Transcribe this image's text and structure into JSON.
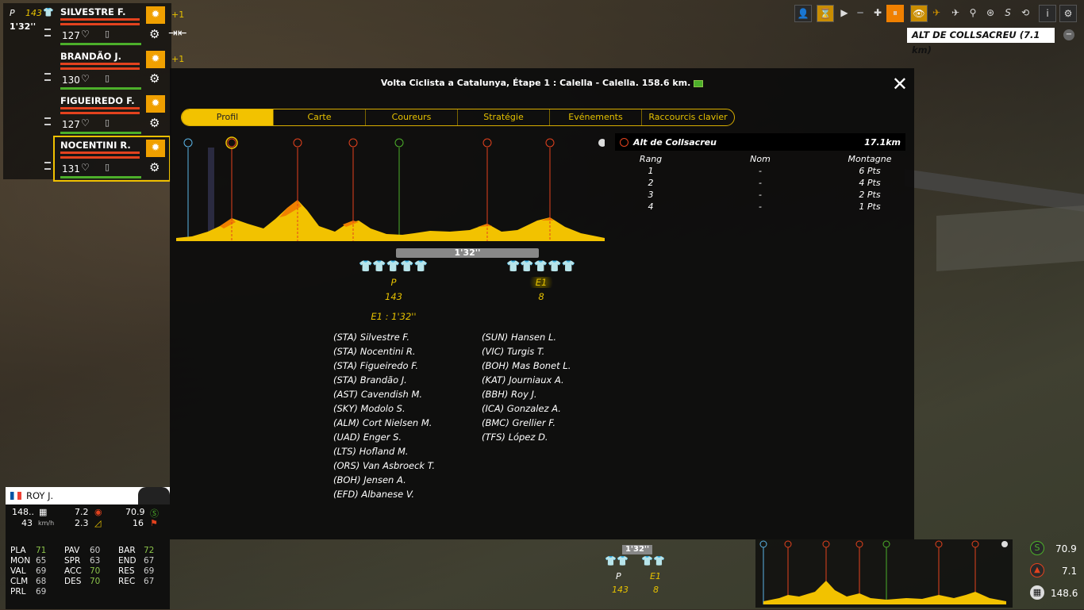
{
  "race": {
    "title": "Volta Ciclista a Catalunya, Étape 1 : Calella - Calella. 158.6 km.",
    "close_label": "✕"
  },
  "tabs": [
    "Profil",
    "Carte",
    "Coureurs",
    "Stratégie",
    "Evénements",
    "Raccourcis clavier"
  ],
  "top_left": {
    "group": "P",
    "count": "143",
    "gap": "1'32''"
  },
  "riders": [
    {
      "name": "SILVESTRE F.",
      "energy": "127",
      "plus": "+1"
    },
    {
      "name": "BRANDÃO J.",
      "energy": "130",
      "plus": "+1"
    },
    {
      "name": "FIGUEIREDO F.",
      "energy": "127",
      "plus": ""
    },
    {
      "name": "NOCENTINI R.",
      "energy": "131",
      "plus": ""
    }
  ],
  "climb": {
    "name": "Alt de Collsacreu",
    "dist": "17.1km",
    "headers": [
      "Rang",
      "Nom",
      "Montagne"
    ],
    "rows": [
      [
        "1",
        "-",
        "6 Pts"
      ],
      [
        "2",
        "-",
        "4 Pts"
      ],
      [
        "3",
        "-",
        "2 Pts"
      ],
      [
        "4",
        "-",
        "1 Pts"
      ]
    ]
  },
  "top_right": {
    "climb_box": "ALT DE COLLSACREU (7.1 km)"
  },
  "gap_bar": "1'32''",
  "groups": {
    "p_label": "P",
    "p_count": "143",
    "e_label": "E1",
    "e_count": "8",
    "e_gap": "E1 : 1'32''"
  },
  "riders_col1": [
    "(STA) Silvestre F.",
    "(STA) Nocentini R.",
    "(STA) Figueiredo F.",
    "(STA) Brandão J.",
    "(AST) Cavendish M.",
    "(SKY) Modolo S.",
    "(ALM) Cort Nielsen M.",
    "(UAD) Enger S.",
    "(LTS) Hofland M.",
    "(ORS) Van Asbroeck T.",
    "(BOH) Jensen A.",
    "(EFD) Albanese V."
  ],
  "riders_col2": [
    "(SUN) Hansen L.",
    "(VIC) Turgis T.",
    "(BOH) Mas Bonet L.",
    "(KAT) Journiaux A.",
    "(BBH) Roy J.",
    "(ICA) Gonzalez A.",
    "(BMC) Grellier F.",
    "(TFS) López D."
  ],
  "selected_rider": {
    "name": "ROY J.",
    "dist_done": "148..",
    "speed": "43",
    "speed_unit": "km/h",
    "km_to_climb": "7.2",
    "grade": "2.3",
    "km_to_sprint": "70.9",
    "km_to_finish": "16",
    "stats": [
      [
        "PLA",
        "71",
        true
      ],
      [
        "PAV",
        "60",
        false
      ],
      [
        "BAR",
        "72",
        true
      ],
      [
        "MON",
        "65",
        false
      ],
      [
        "SPR",
        "63",
        false
      ],
      [
        "END",
        "67",
        false
      ],
      [
        "VAL",
        "69",
        false
      ],
      [
        "ACC",
        "70",
        true
      ],
      [
        "RES",
        "69",
        false
      ],
      [
        "CLM",
        "68",
        false
      ],
      [
        "DES",
        "70",
        true
      ],
      [
        "REC",
        "67",
        false
      ],
      [
        "PRL",
        "69",
        false
      ]
    ]
  },
  "mini": {
    "gap": "1'32''",
    "p_label": "P",
    "p_count": "143",
    "e_label": "E1",
    "e_count": "8"
  },
  "right_stats": {
    "sprint": "70.9",
    "climb": "7.1",
    "finish": "148.6"
  },
  "colors": {
    "accent": "#f2c200",
    "red": "#e3421e",
    "green": "#4caf2a",
    "orange": "#f08000"
  }
}
